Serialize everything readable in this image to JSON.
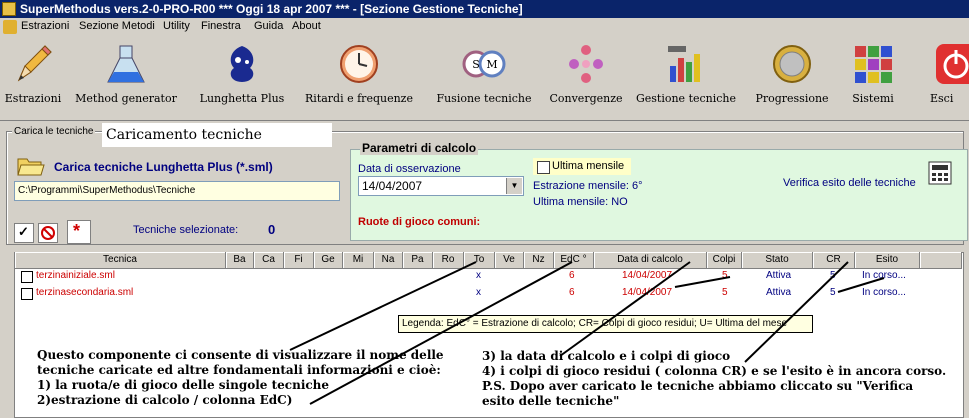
{
  "window": {
    "title": "SuperMethodus vers.2-0-PRO-R00   ***   Oggi 18 apr 2007   ***   - [Sezione Gestione Tecniche]"
  },
  "menu": [
    "Estrazioni",
    "Sezione Metodi",
    "Utility",
    "Finestra",
    "Guida",
    "About"
  ],
  "toolbar": [
    {
      "label": "Estrazioni",
      "icon": "pencil-icon"
    },
    {
      "label": "Method generator",
      "icon": "flask-icon"
    },
    {
      "label": "Lunghetta Plus",
      "icon": "lottery-logo-icon"
    },
    {
      "label": "Ritardi e frequenze",
      "icon": "clock-icon"
    },
    {
      "label": "Fusione tecniche",
      "icon": "rings-icon"
    },
    {
      "label": "Convergenze",
      "icon": "convergence-icon"
    },
    {
      "label": "Gestione tecniche",
      "icon": "tools-chart-icon"
    },
    {
      "label": "Progressione",
      "icon": "coin-icon"
    },
    {
      "label": "Sistemi",
      "icon": "grid-icon"
    },
    {
      "label": "Esci",
      "icon": "power-icon"
    }
  ],
  "carica": {
    "group_label": "Carica le tecniche",
    "callout": "Caricamento tecniche",
    "title": "Carica tecniche Lunghetta Plus (*.sml)",
    "path": "C:\\Programmi\\SuperMethodus\\Tecniche",
    "selected_label": "Tecniche selezionate:",
    "selected_count": "0"
  },
  "params": {
    "title": "Parametri di calcolo",
    "date_label": "Data di osservazione",
    "date_value": "14/04/2007",
    "ultima_mensile_label": "Ultima mensile",
    "estrazione_mensile": "Estrazione mensile: 6°",
    "ultima_mensile_value": "Ultima mensile: NO",
    "ruote_label": "Ruote di gioco comuni:",
    "verifica_link": "Verifica esito delle tecniche"
  },
  "table": {
    "columns": [
      "Tecnica",
      "Ba",
      "Ca",
      "Fi",
      "Ge",
      "Mi",
      "Na",
      "Pa",
      "Ro",
      "To",
      "Ve",
      "Nz",
      "EdC °",
      "Data di calcolo",
      "Colpi",
      "Stato",
      "CR",
      "Esito"
    ],
    "rows": [
      {
        "tecnica": "terzinainiziale.sml",
        "to": "x",
        "edc": "6",
        "data": "14/04/2007",
        "colpi": "5",
        "stato": "Attiva",
        "cr": "5",
        "esito": "In corso..."
      },
      {
        "tecnica": "terzinasecondaria.sml",
        "to": "x",
        "edc": "6",
        "data": "14/04/2007",
        "colpi": "5",
        "stato": "Attiva",
        "cr": "5",
        "esito": "In corso..."
      }
    ],
    "legend_tooltip": "Legenda: EdC° = Estrazione di calcolo; CR= Colpi di gioco residui; U= Ultima del mese"
  },
  "notes": {
    "left": [
      "Questo componente ci consente di visualizzare il nome delle",
      "tecniche caricate ed altre fondamentali informazioni e cioè:",
      "1) la ruota/e di gioco delle singole tecniche",
      "2)estrazione di calcolo / colonna EdC)"
    ],
    "right": [
      "3) la data di calcolo e i colpi di gioco",
      "4) i colpi di gioco residui ( colonna CR) e se l'esito è in ancora corso.",
      "P.S. Dopo aver caricato le tecniche abbiamo cliccato su \"Verifica",
      "esito delle tecniche\""
    ]
  },
  "colors": {
    "titlebar": "#0a246a",
    "tecnica_text": "#cc0000",
    "link_text": "#000080",
    "params_bg": "#e0f8e0"
  }
}
